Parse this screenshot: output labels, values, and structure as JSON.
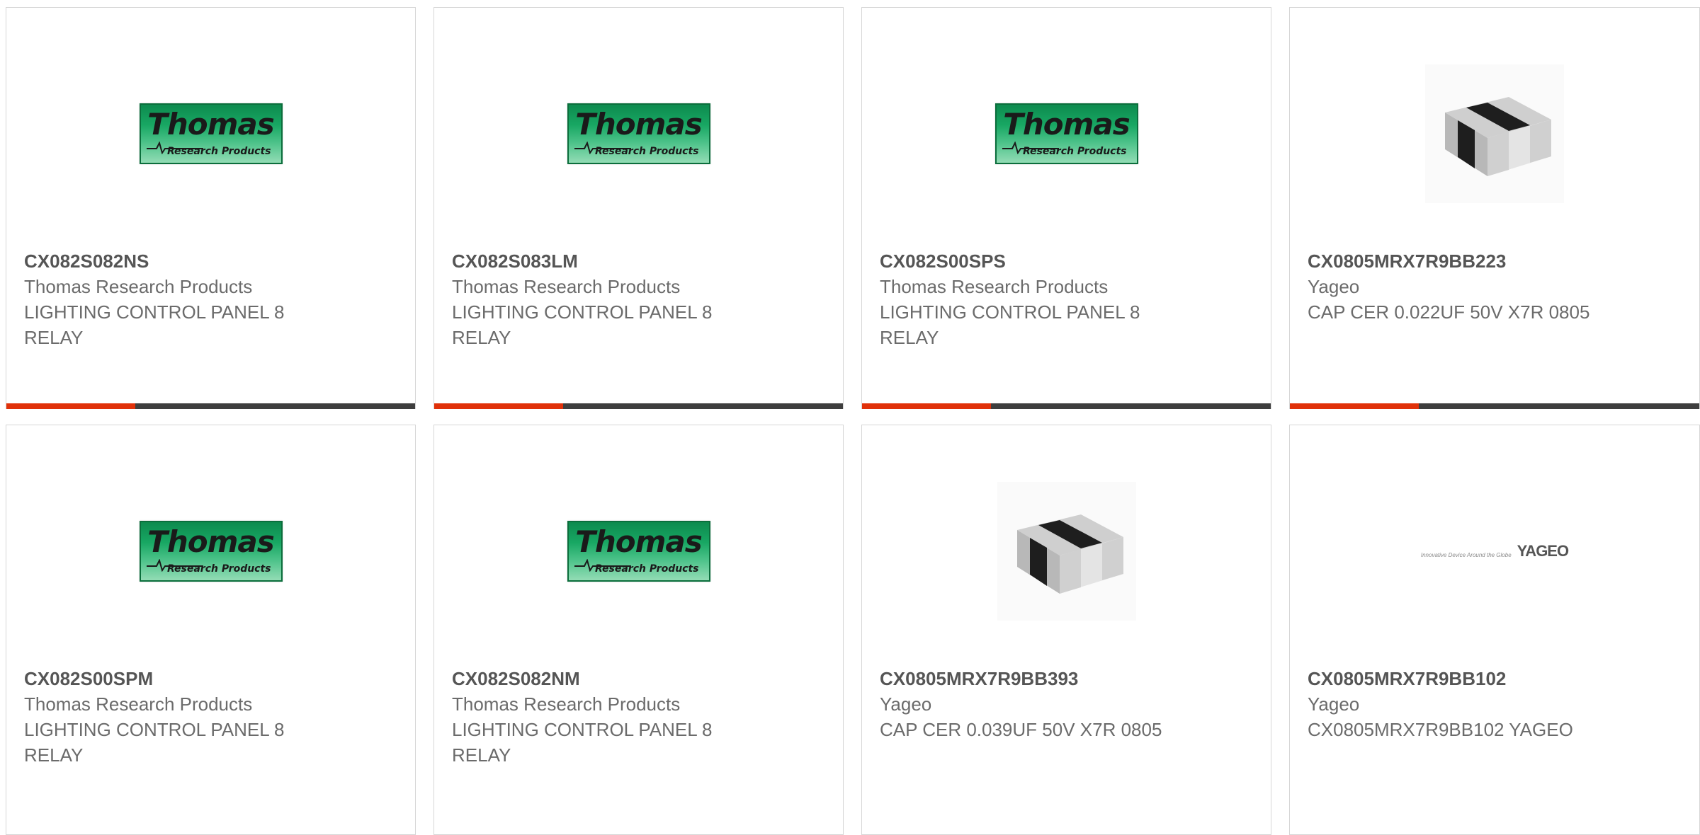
{
  "colors": {
    "accent": "#e0310a",
    "bar": "#3e3e3e",
    "border": "#d6d6d6",
    "part_text": "#555555",
    "body_text": "#6b6b6b",
    "thomas_green": "#18a763"
  },
  "cards": [
    {
      "part": "CX082S082NS",
      "manufacturer": "Thomas Research Products",
      "description": "LIGHTING CONTROL PANEL 8 RELAY",
      "image": "thomas-logo",
      "logo_word": "Thomas",
      "logo_sub": "Research Products"
    },
    {
      "part": "CX082S083LM",
      "manufacturer": "Thomas Research Products",
      "description": "LIGHTING CONTROL PANEL 8 RELAY",
      "image": "thomas-logo",
      "logo_word": "Thomas",
      "logo_sub": "Research Products"
    },
    {
      "part": "CX082S00SPS",
      "manufacturer": "Thomas Research Products",
      "description": "LIGHTING CONTROL PANEL 8 RELAY",
      "image": "thomas-logo",
      "logo_word": "Thomas",
      "logo_sub": "Research Products"
    },
    {
      "part": "CX0805MRX7R9BB223",
      "manufacturer": "Yageo",
      "description": "CAP CER 0.022UF 50V X7R 0805",
      "image": "chip-capacitor-image"
    },
    {
      "part": "CX082S00SPM",
      "manufacturer": "Thomas Research Products",
      "description": "LIGHTING CONTROL PANEL 8 RELAY",
      "image": "thomas-logo",
      "logo_word": "Thomas",
      "logo_sub": "Research Products"
    },
    {
      "part": "CX082S082NM",
      "manufacturer": "Thomas Research Products",
      "description": "LIGHTING CONTROL PANEL 8 RELAY",
      "image": "thomas-logo",
      "logo_word": "Thomas",
      "logo_sub": "Research Products"
    },
    {
      "part": "CX0805MRX7R9BB393",
      "manufacturer": "Yageo",
      "description": "CAP CER 0.039UF 50V X7R 0805",
      "image": "chip-capacitor-image"
    },
    {
      "part": "CX0805MRX7R9BB102",
      "manufacturer": "Yageo",
      "description": "CX0805MRX7R9BB102 YAGEO",
      "image": "yageo-logo",
      "logo_tagline": "Innovative Device Around the Globe",
      "logo_word": "YAGEO"
    }
  ]
}
